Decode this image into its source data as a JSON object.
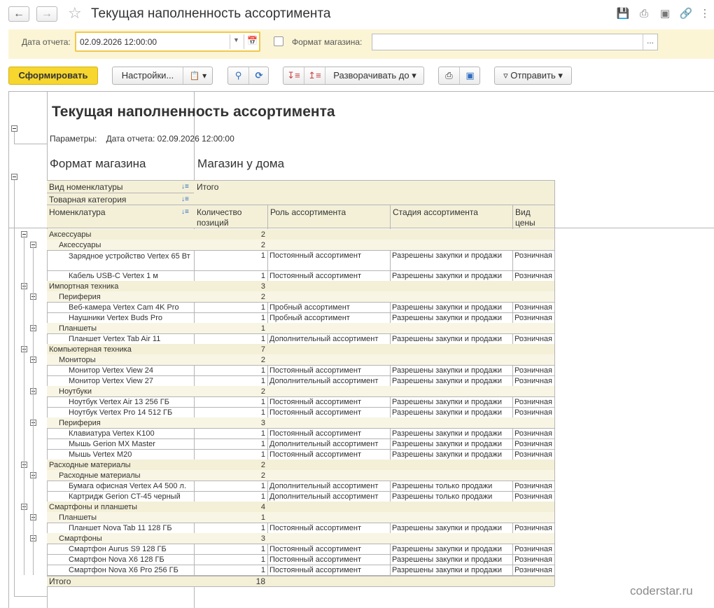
{
  "window": {
    "title": "Текущая наполненность ассортимента"
  },
  "params": {
    "date_label": "Дата отчета:",
    "date_value": "02.09.2026 12:00:00",
    "format_label": "Формат магазина:",
    "format_value": "",
    "format_checked": false
  },
  "toolbar": {
    "generate": "Сформировать",
    "settings": "Настройки...",
    "expand": "Разворачивать до",
    "send": "Отправить"
  },
  "report": {
    "title": "Текущая наполненность ассортимента",
    "params_line": "Параметры:    Дата отчета: 02.09.2026 12:00:00",
    "format_header": "Формат магазина",
    "store_header": "Магазин у дома",
    "hdr_vid": "Вид номенклатуры",
    "hdr_cat": "Товарная категория",
    "hdr_nom": "Номенклатура",
    "hdr_itogo": "Итого",
    "hdr_qty": "Количество позиций",
    "hdr_role": "Роль ассортимента",
    "hdr_stage": "Стадия ассортимента",
    "hdr_price": "Вид цены",
    "total_label": "Итого",
    "total_value": "18",
    "rows": [
      {
        "level": 1,
        "name": "Аксессуары",
        "qty": "2",
        "role": "",
        "stage": "",
        "price": ""
      },
      {
        "level": 2,
        "name": "Аксессуары",
        "qty": "2",
        "role": "",
        "stage": "",
        "price": ""
      },
      {
        "level": 3,
        "name": "Зарядное устройство Vertex 65 Вт",
        "qty": "1",
        "role": "Постоянный ассортимент",
        "stage": "Разрешены закупки и продажи",
        "price": "Розничная",
        "tall": true
      },
      {
        "level": 3,
        "name": "Кабель USB-C Vertex 1 м",
        "qty": "1",
        "role": "Постоянный ассортимент",
        "stage": "Разрешены закупки и продажи",
        "price": "Розничная"
      },
      {
        "level": 1,
        "name": "Импортная техника",
        "qty": "3",
        "role": "",
        "stage": "",
        "price": ""
      },
      {
        "level": 2,
        "name": "Периферия",
        "qty": "2",
        "role": "",
        "stage": "",
        "price": ""
      },
      {
        "level": 3,
        "name": "Веб-камера Vertex Cam 4K Pro",
        "qty": "1",
        "role": "Пробный ассортимент",
        "stage": "Разрешены закупки и продажи",
        "price": "Розничная"
      },
      {
        "level": 3,
        "name": "Наушники Vertex Buds Pro",
        "qty": "1",
        "role": "Пробный ассортимент",
        "stage": "Разрешены закупки и продажи",
        "price": "Розничная"
      },
      {
        "level": 2,
        "name": "Планшеты",
        "qty": "1",
        "role": "",
        "stage": "",
        "price": ""
      },
      {
        "level": 3,
        "name": "Планшет Vertex Tab Air 11",
        "qty": "1",
        "role": "Дополнительный ассортимент",
        "stage": "Разрешены закупки и продажи",
        "price": "Розничная"
      },
      {
        "level": 1,
        "name": "Компьютерная техника",
        "qty": "7",
        "role": "",
        "stage": "",
        "price": ""
      },
      {
        "level": 2,
        "name": "Мониторы",
        "qty": "2",
        "role": "",
        "stage": "",
        "price": ""
      },
      {
        "level": 3,
        "name": "Монитор Vertex View 24",
        "qty": "1",
        "role": "Постоянный ассортимент",
        "stage": "Разрешены закупки и продажи",
        "price": "Розничная"
      },
      {
        "level": 3,
        "name": "Монитор Vertex View 27",
        "qty": "1",
        "role": "Дополнительный ассортимент",
        "stage": "Разрешены закупки и продажи",
        "price": "Розничная"
      },
      {
        "level": 2,
        "name": "Ноутбуки",
        "qty": "2",
        "role": "",
        "stage": "",
        "price": ""
      },
      {
        "level": 3,
        "name": "Ноутбук Vertex Air 13 256 ГБ",
        "qty": "1",
        "role": "Постоянный ассортимент",
        "stage": "Разрешены закупки и продажи",
        "price": "Розничная"
      },
      {
        "level": 3,
        "name": "Ноутбук Vertex Pro 14 512 ГБ",
        "qty": "1",
        "role": "Постоянный ассортимент",
        "stage": "Разрешены закупки и продажи",
        "price": "Розничная"
      },
      {
        "level": 2,
        "name": "Периферия",
        "qty": "3",
        "role": "",
        "stage": "",
        "price": ""
      },
      {
        "level": 3,
        "name": "Клавиатура Vertex K100",
        "qty": "1",
        "role": "Постоянный ассортимент",
        "stage": "Разрешены закупки и продажи",
        "price": "Розничная"
      },
      {
        "level": 3,
        "name": "Мышь Gerion MX Master",
        "qty": "1",
        "role": "Дополнительный ассортимент",
        "stage": "Разрешены закупки и продажи",
        "price": "Розничная"
      },
      {
        "level": 3,
        "name": "Мышь Vertex M20",
        "qty": "1",
        "role": "Постоянный ассортимент",
        "stage": "Разрешены закупки и продажи",
        "price": "Розничная"
      },
      {
        "level": 1,
        "name": "Расходные материалы",
        "qty": "2",
        "role": "",
        "stage": "",
        "price": ""
      },
      {
        "level": 2,
        "name": "Расходные материалы",
        "qty": "2",
        "role": "",
        "stage": "",
        "price": ""
      },
      {
        "level": 3,
        "name": "Бумага офисная Vertex A4 500 л.",
        "qty": "1",
        "role": "Дополнительный ассортимент",
        "stage": "Разрешены только продажи",
        "price": "Розничная"
      },
      {
        "level": 3,
        "name": "Картридж Gerion CT-45 черный",
        "qty": "1",
        "role": "Дополнительный ассортимент",
        "stage": "Разрешены только продажи",
        "price": "Розничная"
      },
      {
        "level": 1,
        "name": "Смартфоны и планшеты",
        "qty": "4",
        "role": "",
        "stage": "",
        "price": ""
      },
      {
        "level": 2,
        "name": "Планшеты",
        "qty": "1",
        "role": "",
        "stage": "",
        "price": ""
      },
      {
        "level": 3,
        "name": "Планшет Nova Tab 11 128 ГБ",
        "qty": "1",
        "role": "Постоянный ассортимент",
        "stage": "Разрешены закупки и продажи",
        "price": "Розничная"
      },
      {
        "level": 2,
        "name": "Смартфоны",
        "qty": "3",
        "role": "",
        "stage": "",
        "price": ""
      },
      {
        "level": 3,
        "name": "Смартфон Aurus S9 128 ГБ",
        "qty": "1",
        "role": "Постоянный ассортимент",
        "stage": "Разрешены закупки и продажи",
        "price": "Розничная"
      },
      {
        "level": 3,
        "name": "Смартфон Nova X6 128 ГБ",
        "qty": "1",
        "role": "Постоянный ассортимент",
        "stage": "Разрешены закупки и продажи",
        "price": "Розничная"
      },
      {
        "level": 3,
        "name": "Смартфон Nova X6 Pro 256 ГБ",
        "qty": "1",
        "role": "Постоянный ассортимент",
        "stage": "Разрешены закупки и продажи",
        "price": "Розничная"
      }
    ]
  },
  "watermark": "coderstar.ru",
  "colors": {
    "accent": "#f7d62d",
    "header_bg": "#f4f0d8",
    "panel_bg": "#fbf5d5"
  }
}
